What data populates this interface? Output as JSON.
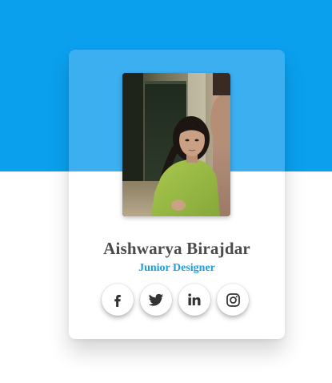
{
  "profile": {
    "name": "Aishwarya Birajdar",
    "role": "Junior Designer"
  },
  "socials": [
    {
      "network": "facebook",
      "icon": "facebook-icon"
    },
    {
      "network": "twitter",
      "icon": "twitter-icon"
    },
    {
      "network": "linkedin",
      "icon": "linkedin-icon"
    },
    {
      "network": "instagram",
      "icon": "instagram-icon"
    }
  ],
  "colors": {
    "header_blue": "#0aa0ee",
    "card_top_blue": "#40b0f0",
    "name_text": "#4a4a4a",
    "role_text": "#1a9fe3",
    "icon": "#333333"
  }
}
